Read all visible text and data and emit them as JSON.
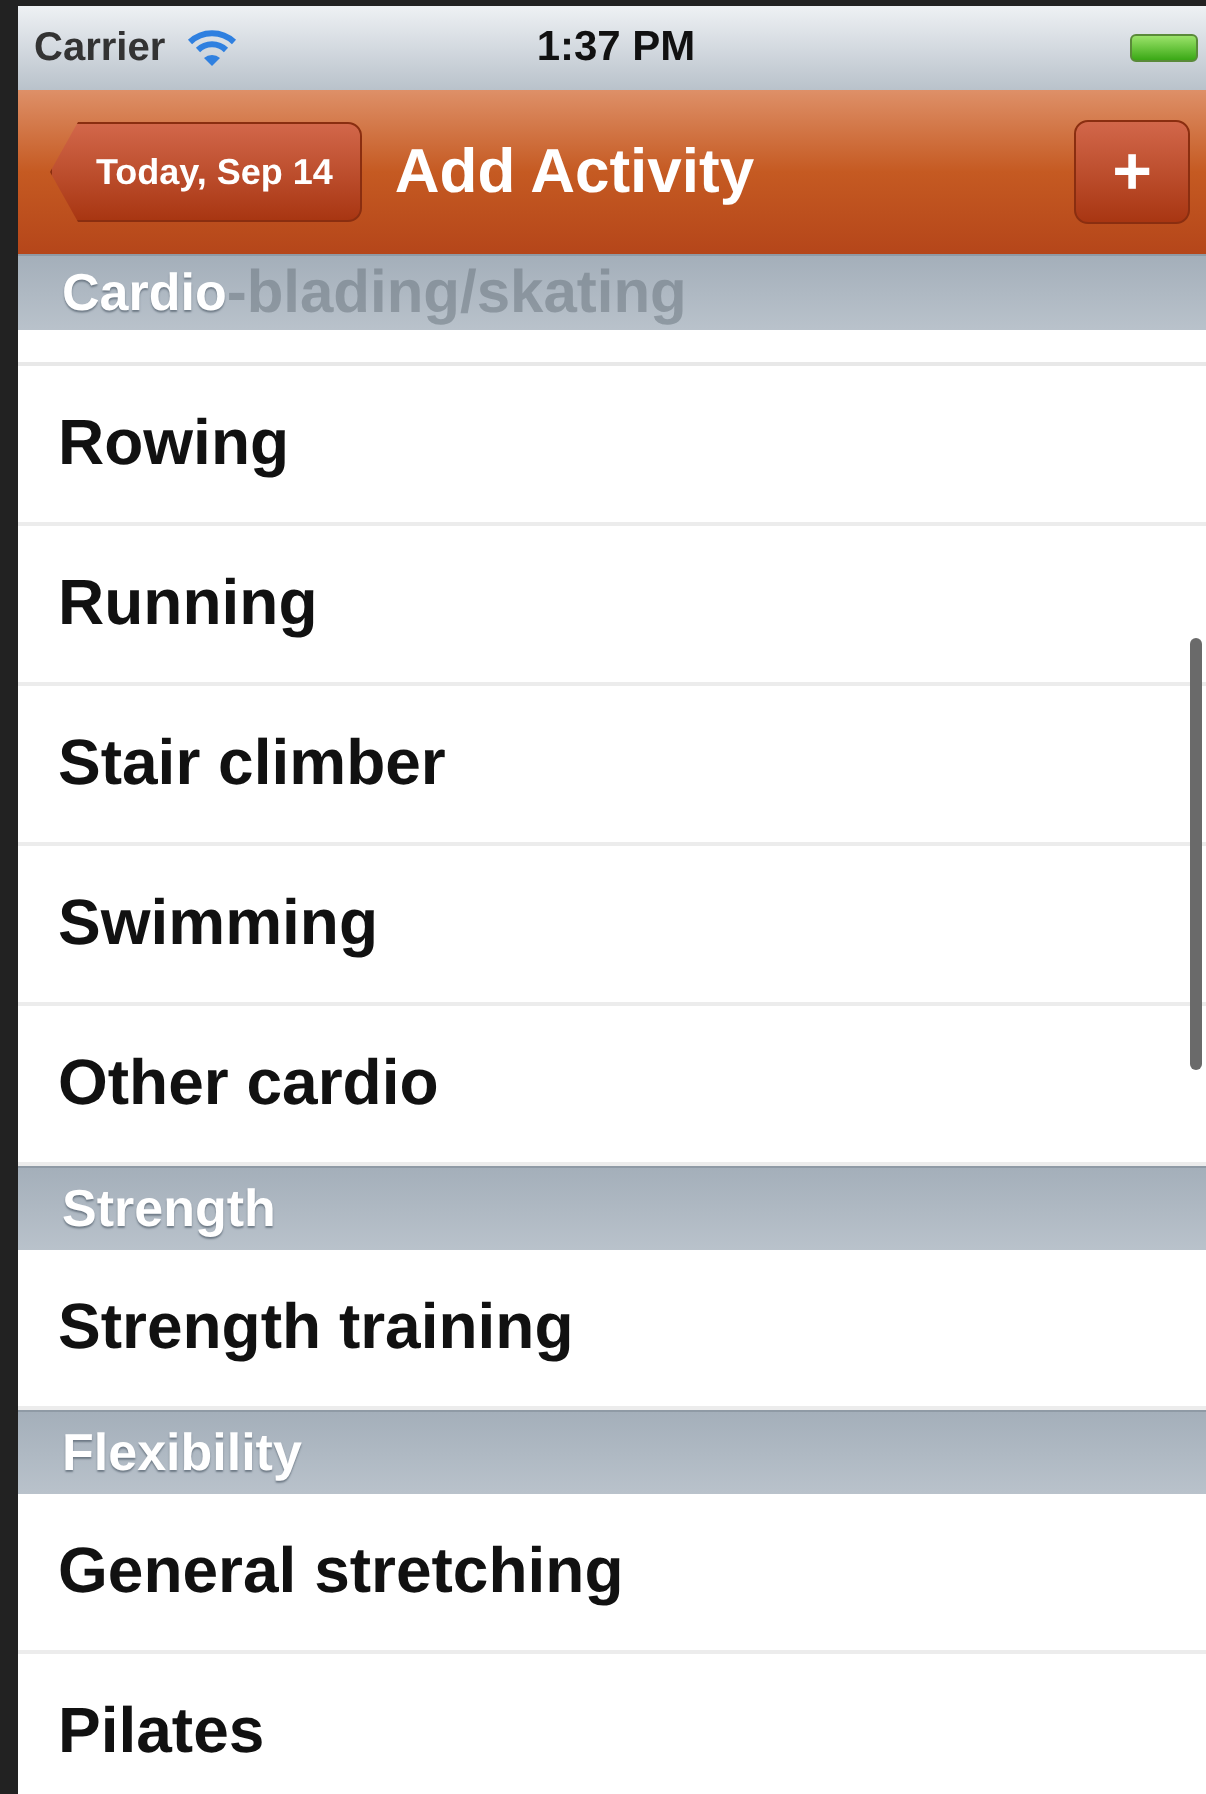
{
  "status_bar": {
    "carrier": "Carrier",
    "time": "1:37 PM"
  },
  "nav_bar": {
    "back_button": "Today, Sep 14",
    "title": "Add Activity",
    "add_button": "+"
  },
  "scrolled_under_text": "-blading/skating",
  "sections": [
    {
      "title": "Cardio",
      "items": [
        "Rowing",
        "Running",
        "Stair climber",
        "Swimming",
        "Other cardio"
      ]
    },
    {
      "title": "Strength",
      "items": [
        "Strength training"
      ]
    },
    {
      "title": "Flexibility",
      "items": [
        "General stretching",
        "Pilates"
      ]
    }
  ]
}
